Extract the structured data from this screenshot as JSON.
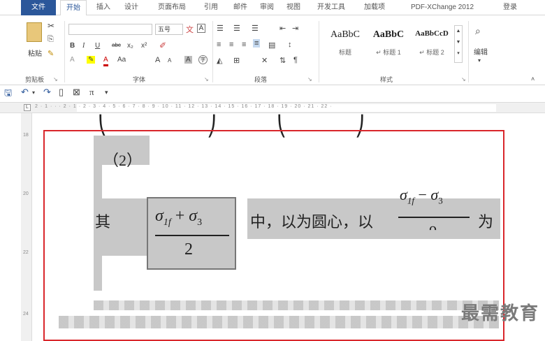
{
  "tabs": [
    "文件",
    "开始",
    "插入",
    "设计",
    "页面布局",
    "引用",
    "邮件",
    "审阅",
    "视图",
    "开发工具",
    "加载项",
    "PDF-XChange 2012",
    "登录"
  ],
  "ribbon": {
    "clipboard": {
      "label": "剪贴板",
      "paste_label": "粘贴"
    },
    "font": {
      "label": "字体",
      "font_name": "",
      "font_size": "五号",
      "bold": "B",
      "italic": "I",
      "underline": "U",
      "strike": "abc",
      "sub": "x₂",
      "sup": "x²",
      "grow": "A",
      "shrink": "A",
      "aa": "Aa"
    },
    "paragraph": {
      "label": "段落"
    },
    "styles": {
      "label": "样式",
      "items": [
        {
          "sample": "AaBbC",
          "name": "标题"
        },
        {
          "sample": "AaBbC",
          "name": "↵ 标题 1"
        },
        {
          "sample": "AaBbCcD",
          "name": "↵ 标题 2"
        }
      ]
    },
    "editing": {
      "label": "编辑"
    }
  },
  "qat": {
    "save_icon": "save-icon",
    "undo_icon": "undo-icon",
    "redo_icon": "redo-icon",
    "pi": "π"
  },
  "ruler": {
    "numbers": "2 · 1 · · · 2 · 1 · 2 · 3 · 4 · 5 · 6 · 7 · 8 · 9 · 10 · 11 · 12 · 13 · 14 · 15 · 16 · 17 · 18 · 19 · 20 · 21 · 22 ·"
  },
  "vruler": [
    "18",
    "20",
    "22",
    "24"
  ],
  "doc": {
    "item_label": "（2）",
    "sentence_prefix": "其",
    "frac_num_a": "σ",
    "frac_num_a_sub": "1f",
    "frac_plus": " + ",
    "frac_num_b": "σ",
    "frac_num_b_sub": "3",
    "frac_den": "2",
    "sentence_mid": "中，以为圆心，以",
    "frac2_num_a": "σ",
    "frac2_num_a_sub": "1f",
    "frac2_minus": " − ",
    "frac2_num_b": "σ",
    "frac2_num_b_sub": "3",
    "sentence_end": "为"
  },
  "watermark": "最需教育"
}
